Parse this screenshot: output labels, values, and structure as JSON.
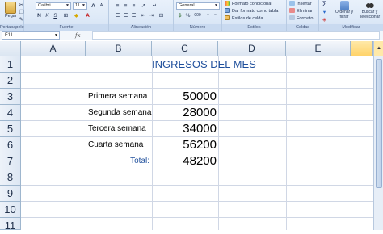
{
  "ribbon": {
    "clipboard": {
      "label": "Portapapeles",
      "paste_label": "Pegar"
    },
    "font": {
      "label": "Fuente",
      "font_name": "Calibri",
      "font_size": "11",
      "grow_glyph": "A",
      "shrink_glyph": "A",
      "bold": "N",
      "italic": "K",
      "underline": "S"
    },
    "alignment": {
      "label": "Alineación"
    },
    "number": {
      "label": "Número",
      "format": "General",
      "percent": "%",
      "thousands": "000"
    },
    "styles": {
      "label": "Estilos",
      "conditional_format": "Formato condicional",
      "format_as_table": "Dar formato como tabla",
      "cell_styles": "Estilos de celda"
    },
    "cells": {
      "label": "Celdas",
      "insert": "Insertar",
      "delete": "Eliminar",
      "format": "Formato"
    },
    "editing": {
      "label": "Modificar",
      "sum": "Σ",
      "sort_filter": "Ordenar y filtrar",
      "find_select": "Buscar y seleccionar"
    }
  },
  "formula_bar": {
    "name_box": "F11",
    "fx": "fx",
    "content": ""
  },
  "columns": [
    "A",
    "B",
    "C",
    "D",
    "E"
  ],
  "rows": [
    "1",
    "2",
    "3",
    "4",
    "5",
    "6",
    "7",
    "8",
    "9",
    "10",
    "11"
  ],
  "sheet": {
    "title": "INGRESOS DEL MES",
    "weeks": [
      {
        "label": "Primera semana",
        "value": "50000"
      },
      {
        "label": "Segunda semana",
        "value": "28000"
      },
      {
        "label": "Tercera semana",
        "value": "34000"
      },
      {
        "label": "Cuarta semana",
        "value": "56200"
      }
    ],
    "total_label": "Total:",
    "total_value": "48200"
  },
  "colors": {
    "title": "#1f4f9c",
    "header_bg": "#dbe5f1",
    "ribbon_bg": "#d6e4f5"
  }
}
